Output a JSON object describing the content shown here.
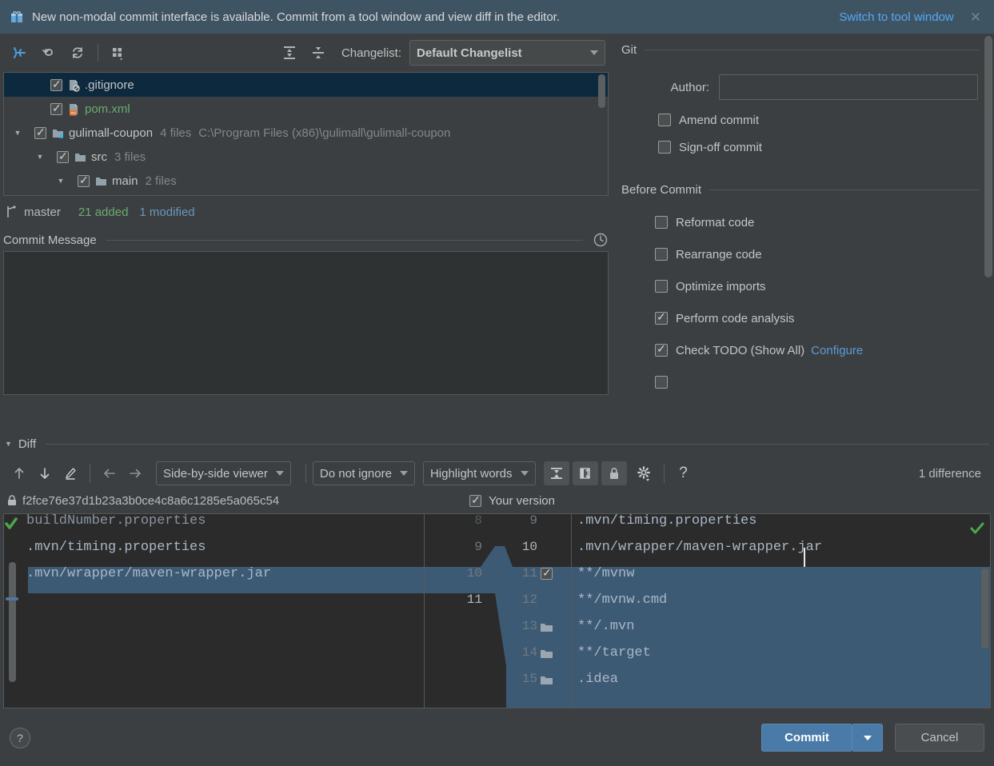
{
  "banner": {
    "icon": "gift-icon",
    "message": "New non-modal commit interface is available. Commit from a tool window and view diff in the editor.",
    "action_link": "Switch to tool window",
    "close": "✕"
  },
  "toolbar": {
    "buttons": [
      {
        "name": "show-diff-icon",
        "title": "Show Diff"
      },
      {
        "name": "revert-icon",
        "title": "Revert"
      },
      {
        "name": "refresh-icon",
        "title": "Refresh"
      },
      {
        "name": "group-by-icon",
        "title": "Group By"
      }
    ],
    "expand_all": "expand-all-icon",
    "collapse_all": "collapse-all-icon",
    "changelist_label": "Changelist:",
    "changelist_value": "Default Changelist"
  },
  "tree": {
    "rows": [
      {
        "indent": 0,
        "arrow": "",
        "checked": true,
        "icon": "gitignore-file-icon",
        "name": ".gitignore",
        "color": "normal",
        "meta": "",
        "path": "",
        "selected": true
      },
      {
        "indent": 0,
        "arrow": "",
        "checked": true,
        "icon": "xml-file-icon",
        "name": "pom.xml",
        "color": "green",
        "meta": "",
        "path": "",
        "selected": false
      },
      {
        "indent": 0,
        "arrow": "▼",
        "checked": true,
        "icon": "module-icon",
        "name": "gulimall-coupon",
        "color": "normal",
        "meta": "4 files",
        "path": "C:\\Program Files (x86)\\gulimall\\gulimall-coupon",
        "selected": false
      },
      {
        "indent": 1,
        "arrow": "▼",
        "checked": true,
        "icon": "folder-icon",
        "name": "src",
        "color": "normal",
        "meta": "3 files",
        "path": "",
        "selected": false
      },
      {
        "indent": 2,
        "arrow": "▼",
        "checked": true,
        "icon": "folder-icon",
        "name": "main",
        "color": "normal",
        "meta": "2 files",
        "path": "",
        "selected": false
      }
    ]
  },
  "status": {
    "branch_icon": "branch-icon",
    "branch": "master",
    "added": "21 added",
    "modified": "1 modified"
  },
  "commit_message": {
    "title": "Commit Message",
    "history_icon": "clock-icon",
    "value": "",
    "placeholder": ""
  },
  "git_panel": {
    "group_title": "Git",
    "author_label": "Author:",
    "author_value": "",
    "author_placeholder": "",
    "options": [
      {
        "label": "Amend commit",
        "checked": false
      },
      {
        "label": "Sign-off commit",
        "checked": false
      }
    ]
  },
  "before_commit": {
    "group_title": "Before Commit",
    "options": [
      {
        "label": "Reformat code",
        "checked": false,
        "link": ""
      },
      {
        "label": "Rearrange code",
        "checked": false,
        "link": ""
      },
      {
        "label": "Optimize imports",
        "checked": false,
        "link": ""
      },
      {
        "label": "Perform code analysis",
        "checked": true,
        "link": ""
      },
      {
        "label": "Check TODO (Show All)",
        "checked": true,
        "link": "Configure"
      }
    ]
  },
  "diff": {
    "section_title": "Diff",
    "collapse_arrow": "▼",
    "nav_prev_icon": "arrow-up-icon",
    "nav_next_icon": "arrow-down-icon",
    "edit_icon": "pencil-icon",
    "accept_left_icon": "arrow-left-icon",
    "accept_right_icon": "arrow-right-icon",
    "viewer_mode": "Side-by-side viewer",
    "ignore_mode": "Do not ignore",
    "highlight_mode": "Highlight words",
    "collapse_unchanged_icon": "collapse-unchanged-icon",
    "compare_columns_icon": "compare-columns-icon",
    "lock_toggle_icon": "lock-icon",
    "settings_icon": "gear-icon",
    "help_icon": "question-icon",
    "difference_count": "1 difference",
    "revision_lock_icon": "lock-icon",
    "revision_hash": "f2fce76e37d1b23a3b0ce4c8a6c1285e5a065c54",
    "your_version_label": "Your version",
    "your_version_checked": true,
    "left_lines": [
      {
        "num": "8",
        "text": "buildNumber.properties",
        "clipped": true,
        "highlight": false,
        "icon": ""
      },
      {
        "num": "9",
        "text": ".mvn/timing.properties",
        "clipped": false,
        "highlight": false,
        "icon": ""
      },
      {
        "num": "10",
        "text": ".mvn/wrapper/maven-wrapper.jar",
        "clipped": false,
        "highlight": false,
        "icon": ""
      },
      {
        "num": "11",
        "text": "",
        "clipped": false,
        "highlight": true,
        "icon": ""
      }
    ],
    "right_lines": [
      {
        "num": "9",
        "text": ".mvn/timing.properties",
        "clipped": false,
        "highlight": false,
        "icon": "",
        "checkbox": false
      },
      {
        "num": "10",
        "text": ".mvn/wrapper/maven-wrapper.jar",
        "clipped": false,
        "highlight": false,
        "icon": "",
        "checkbox": false,
        "caret": true
      },
      {
        "num": "11",
        "text": "**/mvnw",
        "clipped": false,
        "highlight": true,
        "icon": "",
        "checkbox": true
      },
      {
        "num": "12",
        "text": "**/mvnw.cmd",
        "clipped": false,
        "highlight": true,
        "icon": "",
        "checkbox": false
      },
      {
        "num": "13",
        "text": "**/.mvn",
        "clipped": false,
        "highlight": true,
        "icon": "folder-icon",
        "checkbox": false
      },
      {
        "num": "14",
        "text": "**/target",
        "clipped": false,
        "highlight": true,
        "icon": "folder-icon",
        "checkbox": false
      },
      {
        "num": "15",
        "text": ".idea",
        "clipped": false,
        "highlight": true,
        "icon": "folder-icon",
        "checkbox": false
      }
    ]
  },
  "footer": {
    "help_label": "?",
    "commit_label": "Commit",
    "commit_dropdown_icon": "chevron-down-icon",
    "cancel_label": "Cancel"
  },
  "colors": {
    "accent_blue": "#4a7ba8",
    "link_blue": "#56a8f5",
    "added_green": "#6aab73",
    "modified_blue": "#6897bb",
    "banner_bg": "#3f5463",
    "panel_bg": "#3c3f41",
    "editor_bg": "#2b2b2b",
    "diff_highlight": "#3d5a75",
    "selection_bg": "#0d293e"
  }
}
